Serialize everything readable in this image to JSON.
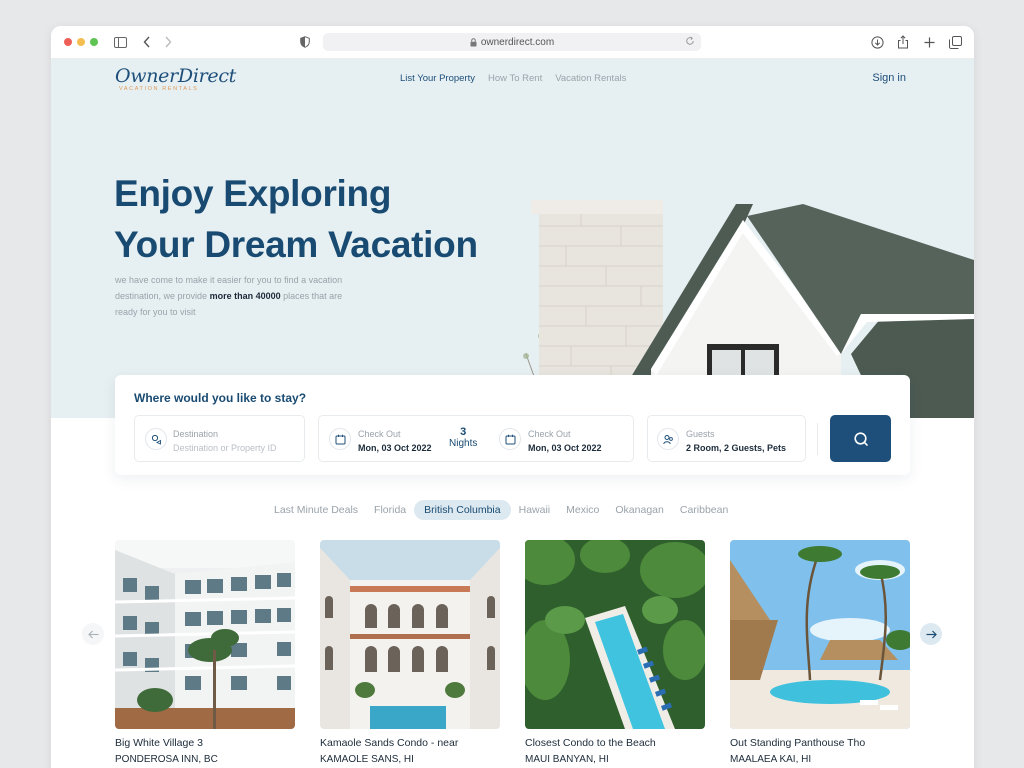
{
  "browser": {
    "url": "ownerdirect.com",
    "icons": [
      "sidebar-icon",
      "back-icon",
      "forward-icon",
      "shield-icon",
      "lock-icon",
      "reload-icon",
      "download-icon",
      "share-icon",
      "new-tab-icon",
      "tabs-icon"
    ]
  },
  "brand": {
    "logo_main": "OwnerDirect",
    "logo_sub": "VACATION RENTALS",
    "accent": "#1d4f7a",
    "logo_sub_color": "#e09a5a"
  },
  "nav": {
    "items": [
      {
        "label": "List Your Property",
        "active": true
      },
      {
        "label": "How To Rent",
        "active": false
      },
      {
        "label": "Vacation Rentals",
        "active": false
      }
    ],
    "signin": "Sign in"
  },
  "hero": {
    "title_line1": "Enjoy Exploring",
    "title_line2": "Your Dream Vacation",
    "desc_part1": "we have come to make it easier for you to find a vacation destination, we provide ",
    "desc_bold": "more than 40000",
    "desc_part2": " places that are ready for you to visit"
  },
  "search": {
    "title": "Where would you like to stay?",
    "destination": {
      "label": "Destination",
      "placeholder": "Destination or Property ID"
    },
    "checkin": {
      "label": "Check Out",
      "value": "Mon, 03 Oct 2022"
    },
    "nights": {
      "count": "3",
      "label": "Nights"
    },
    "checkout": {
      "label": "Check Out",
      "value": "Mon, 03 Oct 2022"
    },
    "guests": {
      "label": "Guests",
      "value": "2 Room, 2 Guests, Pets"
    }
  },
  "tabs": [
    {
      "label": "Last Minute Deals",
      "active": false
    },
    {
      "label": "Florida",
      "active": false
    },
    {
      "label": "British Columbia",
      "active": true
    },
    {
      "label": "Hawaii",
      "active": false
    },
    {
      "label": "Mexico",
      "active": false
    },
    {
      "label": "Okanagan",
      "active": false
    },
    {
      "label": "Caribbean",
      "active": false
    }
  ],
  "listings": [
    {
      "title": "Big White Village 3",
      "location": "PONDEROSA INN, BC"
    },
    {
      "title": "Kamaole Sands Condo - near",
      "location": "KAMAOLE SANS, HI"
    },
    {
      "title": "Closest Condo to the Beach",
      "location": "MAUI BANYAN, HI"
    },
    {
      "title": "Out Standing Panthouse Tho",
      "location": "MAALAEA KAI, HI"
    }
  ]
}
